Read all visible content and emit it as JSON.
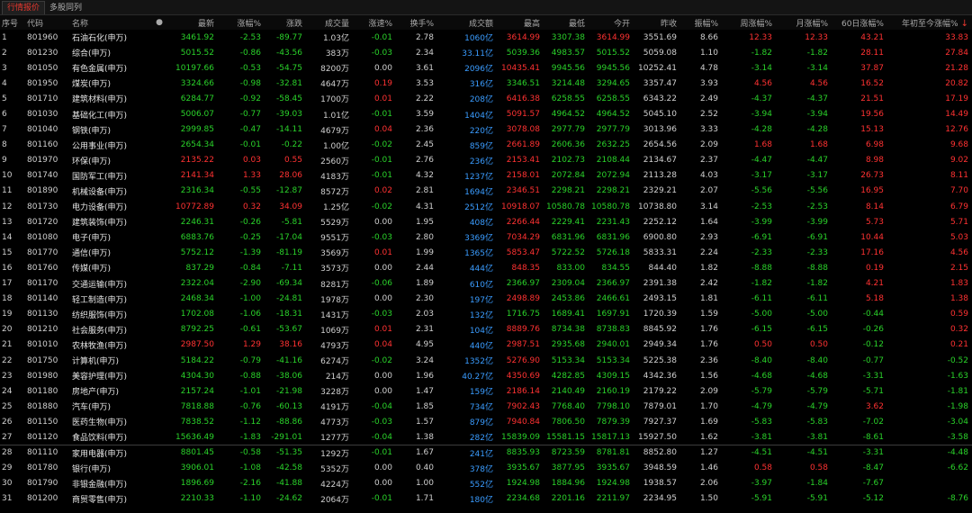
{
  "tabs": [
    "行情报价",
    "多股同列"
  ],
  "columns": [
    "序号",
    "代码",
    "名称",
    "●",
    "最新",
    "涨幅%",
    "涨跌",
    "成交量",
    "涨速%",
    "换手%",
    "成交额",
    "最高",
    "最低",
    "今开",
    "昨收",
    "振幅%",
    "周涨幅%",
    "月涨幅%",
    "60日涨幅%",
    "年初至今涨幅%"
  ],
  "sort_indicator": "↓",
  "rows": [
    [
      "1",
      "801960",
      "石油石化(申万)",
      "3461.92",
      "-2.53",
      "-89.77",
      "1.03亿",
      "-0.01",
      "2.78",
      "1060亿",
      "3614.99",
      "3307.38",
      "3614.99",
      "3551.69",
      "8.66",
      "12.33",
      "12.33",
      "43.21",
      "33.83"
    ],
    [
      "2",
      "801230",
      "综合(申万)",
      "5015.52",
      "-0.86",
      "-43.56",
      "383万",
      "-0.03",
      "2.34",
      "33.11亿",
      "5039.36",
      "4983.57",
      "5015.52",
      "5059.08",
      "1.10",
      "-1.82",
      "-1.82",
      "28.11",
      "27.84"
    ],
    [
      "3",
      "801050",
      "有色金属(申万)",
      "10197.66",
      "-0.53",
      "-54.75",
      "8200万",
      "0.00",
      "3.61",
      "2096亿",
      "10435.41",
      "9945.56",
      "9945.56",
      "10252.41",
      "4.78",
      "-3.14",
      "-3.14",
      "37.87",
      "21.28"
    ],
    [
      "4",
      "801950",
      "煤炭(申万)",
      "3324.66",
      "-0.98",
      "-32.81",
      "4647万",
      "0.19",
      "3.53",
      "316亿",
      "3346.51",
      "3214.48",
      "3294.65",
      "3357.47",
      "3.93",
      "4.56",
      "4.56",
      "16.52",
      "20.82"
    ],
    [
      "5",
      "801710",
      "建筑材料(申万)",
      "6284.77",
      "-0.92",
      "-58.45",
      "1700万",
      "0.01",
      "2.22",
      "208亿",
      "6416.38",
      "6258.55",
      "6258.55",
      "6343.22",
      "2.49",
      "-4.37",
      "-4.37",
      "21.51",
      "17.19"
    ],
    [
      "6",
      "801030",
      "基础化工(申万)",
      "5006.07",
      "-0.77",
      "-39.03",
      "1.01亿",
      "-0.01",
      "3.59",
      "1404亿",
      "5091.57",
      "4964.52",
      "4964.52",
      "5045.10",
      "2.52",
      "-3.94",
      "-3.94",
      "19.56",
      "14.49"
    ],
    [
      "7",
      "801040",
      "钢铁(申万)",
      "2999.85",
      "-0.47",
      "-14.11",
      "4679万",
      "0.04",
      "2.36",
      "220亿",
      "3078.08",
      "2977.79",
      "2977.79",
      "3013.96",
      "3.33",
      "-4.28",
      "-4.28",
      "15.13",
      "12.76"
    ],
    [
      "8",
      "801160",
      "公用事业(申万)",
      "2654.34",
      "-0.01",
      "-0.22",
      "1.00亿",
      "-0.02",
      "2.45",
      "859亿",
      "2661.89",
      "2606.36",
      "2632.25",
      "2654.56",
      "2.09",
      "1.68",
      "1.68",
      "6.98",
      "9.68"
    ],
    [
      "9",
      "801970",
      "环保(申万)",
      "2135.22",
      "0.03",
      "0.55",
      "2560万",
      "-0.01",
      "2.76",
      "236亿",
      "2153.41",
      "2102.73",
      "2108.44",
      "2134.67",
      "2.37",
      "-4.47",
      "-4.47",
      "8.98",
      "9.02"
    ],
    [
      "10",
      "801740",
      "国防军工(申万)",
      "2141.34",
      "1.33",
      "28.06",
      "4183万",
      "-0.01",
      "4.32",
      "1237亿",
      "2158.01",
      "2072.84",
      "2072.94",
      "2113.28",
      "4.03",
      "-3.17",
      "-3.17",
      "26.73",
      "8.11"
    ],
    [
      "11",
      "801890",
      "机械设备(申万)",
      "2316.34",
      "-0.55",
      "-12.87",
      "8572万",
      "0.02",
      "2.81",
      "1694亿",
      "2346.51",
      "2298.21",
      "2298.21",
      "2329.21",
      "2.07",
      "-5.56",
      "-5.56",
      "16.95",
      "7.70"
    ],
    [
      "12",
      "801730",
      "电力设备(申万)",
      "10772.89",
      "0.32",
      "34.09",
      "1.25亿",
      "-0.02",
      "4.31",
      "2512亿",
      "10918.07",
      "10580.78",
      "10580.78",
      "10738.80",
      "3.14",
      "-2.53",
      "-2.53",
      "8.14",
      "6.79"
    ],
    [
      "13",
      "801720",
      "建筑装饰(申万)",
      "2246.31",
      "-0.26",
      "-5.81",
      "5529万",
      "0.00",
      "1.95",
      "408亿",
      "2266.44",
      "2229.41",
      "2231.43",
      "2252.12",
      "1.64",
      "-3.99",
      "-3.99",
      "5.73",
      "5.71"
    ],
    [
      "14",
      "801080",
      "电子(申万)",
      "6883.76",
      "-0.25",
      "-17.04",
      "9551万",
      "-0.03",
      "2.80",
      "3369亿",
      "7034.29",
      "6831.96",
      "6831.96",
      "6900.80",
      "2.93",
      "-6.91",
      "-6.91",
      "10.44",
      "5.03"
    ],
    [
      "15",
      "801770",
      "通信(申万)",
      "5752.12",
      "-1.39",
      "-81.19",
      "3569万",
      "0.01",
      "1.99",
      "1365亿",
      "5853.47",
      "5722.52",
      "5726.18",
      "5833.31",
      "2.24",
      "-2.33",
      "-2.33",
      "17.16",
      "4.56"
    ],
    [
      "16",
      "801760",
      "传媒(申万)",
      "837.29",
      "-0.84",
      "-7.11",
      "3573万",
      "0.00",
      "2.44",
      "444亿",
      "848.35",
      "833.00",
      "834.55",
      "844.40",
      "1.82",
      "-8.88",
      "-8.88",
      "0.19",
      "2.15"
    ],
    [
      "17",
      "801170",
      "交通运输(申万)",
      "2322.04",
      "-2.90",
      "-69.34",
      "8281万",
      "-0.06",
      "1.89",
      "610亿",
      "2366.97",
      "2309.04",
      "2366.97",
      "2391.38",
      "2.42",
      "-1.82",
      "-1.82",
      "4.21",
      "1.83"
    ],
    [
      "18",
      "801140",
      "轻工制造(申万)",
      "2468.34",
      "-1.00",
      "-24.81",
      "1978万",
      "0.00",
      "2.30",
      "197亿",
      "2498.89",
      "2453.86",
      "2466.61",
      "2493.15",
      "1.81",
      "-6.11",
      "-6.11",
      "5.18",
      "1.38"
    ],
    [
      "19",
      "801130",
      "纺织服饰(申万)",
      "1702.08",
      "-1.06",
      "-18.31",
      "1431万",
      "-0.03",
      "2.03",
      "132亿",
      "1716.75",
      "1689.41",
      "1697.91",
      "1720.39",
      "1.59",
      "-5.00",
      "-5.00",
      "-0.44",
      "0.59"
    ],
    [
      "20",
      "801210",
      "社会服务(申万)",
      "8792.25",
      "-0.61",
      "-53.67",
      "1069万",
      "0.01",
      "2.31",
      "104亿",
      "8889.76",
      "8734.38",
      "8738.83",
      "8845.92",
      "1.76",
      "-6.15",
      "-6.15",
      "-0.26",
      "0.32"
    ],
    [
      "21",
      "801010",
      "农林牧渔(申万)",
      "2987.50",
      "1.29",
      "38.16",
      "4793万",
      "0.04",
      "4.95",
      "440亿",
      "2987.51",
      "2935.68",
      "2940.01",
      "2949.34",
      "1.76",
      "0.50",
      "0.50",
      "-0.12",
      "0.21"
    ],
    [
      "22",
      "801750",
      "计算机(申万)",
      "5184.22",
      "-0.79",
      "-41.16",
      "6274万",
      "-0.02",
      "3.24",
      "1352亿",
      "5276.90",
      "5153.34",
      "5153.34",
      "5225.38",
      "2.36",
      "-8.40",
      "-8.40",
      "-0.77",
      "-0.52"
    ],
    [
      "23",
      "801980",
      "美容护理(申万)",
      "4304.30",
      "-0.88",
      "-38.06",
      "214万",
      "0.00",
      "1.96",
      "40.27亿",
      "4350.69",
      "4282.85",
      "4309.15",
      "4342.36",
      "1.56",
      "-4.68",
      "-4.68",
      "-3.31",
      "-1.63"
    ],
    [
      "24",
      "801180",
      "房地产(申万)",
      "2157.24",
      "-1.01",
      "-21.98",
      "3228万",
      "0.00",
      "1.47",
      "159亿",
      "2186.14",
      "2140.49",
      "2160.19",
      "2179.22",
      "2.09",
      "-5.79",
      "-5.79",
      "-5.71",
      "-1.81"
    ],
    [
      "25",
      "801880",
      "汽车(申万)",
      "7818.88",
      "-0.76",
      "-60.13",
      "4191万",
      "-0.04",
      "1.85",
      "734亿",
      "7902.43",
      "7768.40",
      "7798.10",
      "7879.01",
      "1.70",
      "-4.79",
      "-4.79",
      "3.62",
      "-1.98"
    ],
    [
      "26",
      "801150",
      "医药生物(申万)",
      "7838.52",
      "-1.12",
      "-88.86",
      "4773万",
      "-0.03",
      "1.57",
      "879亿",
      "7940.84",
      "7806.50",
      "7879.39",
      "7927.37",
      "1.69",
      "-5.83",
      "-5.83",
      "-7.02",
      "-3.04"
    ],
    [
      "27",
      "801120",
      "食品饮料(申万)",
      "15636.49",
      "-1.83",
      "-291.01",
      "1277万",
      "-0.04",
      "1.38",
      "282亿",
      "15839.09",
      "15581.15",
      "15817.13",
      "15927.50",
      "1.62",
      "-3.81",
      "-3.81",
      "-8.61",
      "-3.58"
    ],
    [
      "28",
      "801110",
      "家用电器(申万)",
      "8801.45",
      "-0.58",
      "-51.35",
      "1292万",
      "-0.01",
      "1.67",
      "241亿",
      "8835.93",
      "8723.59",
      "8781.81",
      "8852.80",
      "1.27",
      "-4.51",
      "-4.51",
      "-3.31",
      "-4.48"
    ],
    [
      "29",
      "801780",
      "银行(申万)",
      "3906.01",
      "-1.08",
      "-42.58",
      "5352万",
      "0.00",
      "0.40",
      "378亿",
      "3935.67",
      "3877.95",
      "3935.67",
      "3948.59",
      "1.46",
      "0.58",
      "0.58",
      "-8.47",
      "-6.62"
    ],
    [
      "30",
      "801790",
      "非银金融(申万)",
      "1896.69",
      "-2.16",
      "-41.88",
      "4224万",
      "0.00",
      "1.00",
      "552亿",
      "1924.98",
      "1884.96",
      "1924.98",
      "1938.57",
      "2.06",
      "-3.97",
      "-1.84",
      "-7.67"
    ],
    [
      "31",
      "801200",
      "商贸零售(申万)",
      "2210.33",
      "-1.10",
      "-24.62",
      "2064万",
      "-0.01",
      "1.71",
      "180亿",
      "2234.68",
      "2201.16",
      "2211.97",
      "2234.95",
      "1.50",
      "-5.91",
      "-5.91",
      "-5.12",
      "-8.76"
    ]
  ]
}
